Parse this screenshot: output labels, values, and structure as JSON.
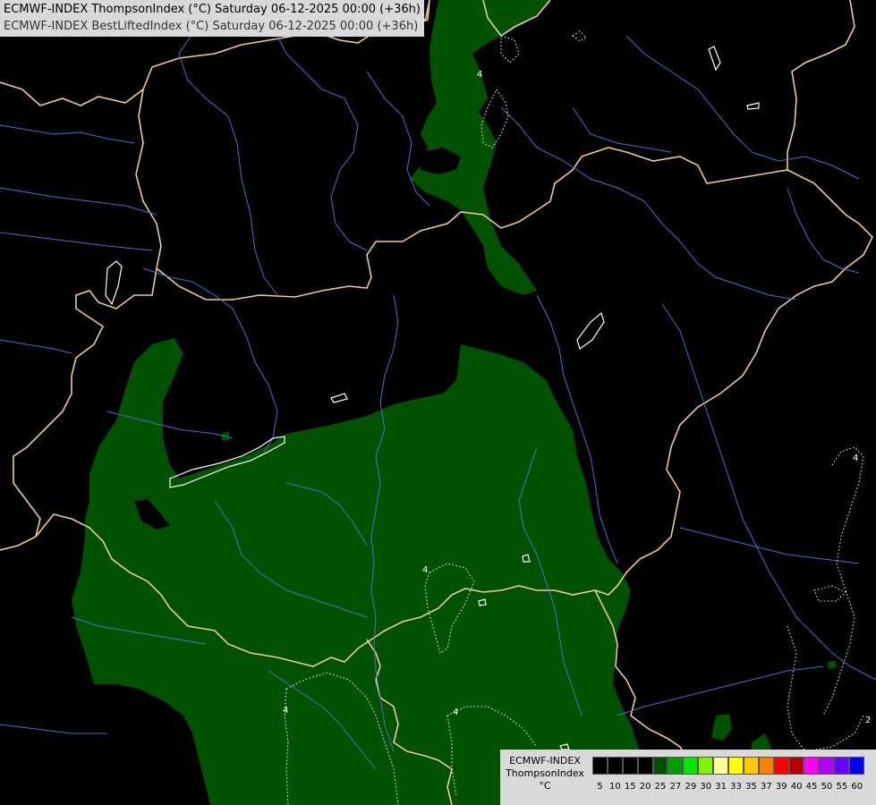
{
  "header": {
    "line1": "ECMWF-INDEX ThompsonIndex (°C) Saturday 06-12-2025 00:00 (+36h)",
    "line2": "ECMWF-INDEX BestLiftedIndex (°C) Saturday 06-12-2025 00:00 (+36h)"
  },
  "legend": {
    "title_lines": [
      "ECMWF-INDEX",
      "ThompsonIndex",
      "°C"
    ],
    "colors": [
      "#000000",
      "#000000",
      "#000000",
      "#000000",
      "#005200",
      "#009e00",
      "#00e600",
      "#7df500",
      "#ffff99",
      "#ffff00",
      "#ffc800",
      "#ff8000",
      "#ff0000",
      "#b30000",
      "#ff00ff",
      "#b300ff",
      "#6a00ff",
      "#0000ff"
    ],
    "ticks": [
      "5",
      "10",
      "15",
      "20",
      "25",
      "27",
      "29",
      "30",
      "31",
      "33",
      "35",
      "37",
      "39",
      "40",
      "45",
      "50",
      "55",
      "60"
    ]
  },
  "contour_labels": [
    "4",
    "4",
    "4",
    "4",
    "2",
    "4"
  ],
  "colors": {
    "field": "#005200",
    "border": "#f0c99a",
    "river": "#4a6fd0",
    "contour": "#ffffff"
  }
}
